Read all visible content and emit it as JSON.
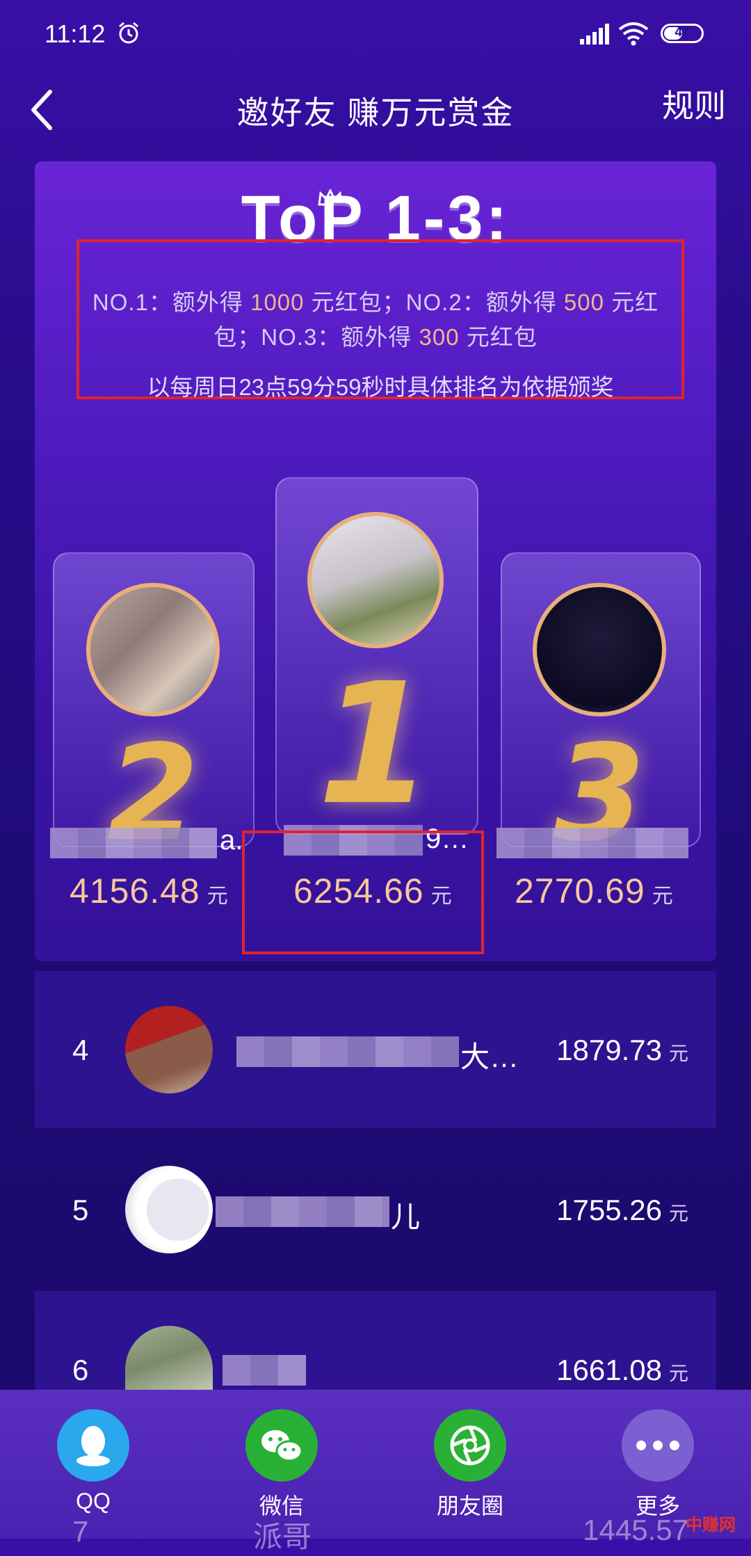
{
  "status_bar": {
    "time": "11:12",
    "battery": "47"
  },
  "header": {
    "title": "邀好友 赚万元赏金",
    "rules": "规则"
  },
  "top_section": {
    "title": "ToP 1-3:",
    "rule_line1": {
      "a": "NO.1：额外得 ",
      "n1": "1000",
      "b": " 元红包；NO.2：额外得 ",
      "n2": "500",
      "c": " 元红"
    },
    "rule_line2": {
      "a": "包；NO.3：额外得 ",
      "n3": "300",
      "b": " 元红包"
    },
    "note": "以每周日23点59分59秒时具体排名为依据颁奖"
  },
  "podium": [
    {
      "rank": "2",
      "name_suffix": "a.",
      "amount": "4156.48",
      "unit": "元"
    },
    {
      "rank": "1",
      "name_suffix": "9…",
      "amount": "6254.66",
      "unit": "元"
    },
    {
      "rank": "3",
      "name_suffix": "",
      "amount": "2770.69",
      "unit": "元"
    }
  ],
  "list": [
    {
      "rank": "4",
      "name_suffix": "大…",
      "amount": "1879.73",
      "unit": "元"
    },
    {
      "rank": "5",
      "name_suffix": "儿",
      "amount": "1755.26",
      "unit": "元"
    },
    {
      "rank": "6",
      "name_suffix": "",
      "amount": "1661.08",
      "unit": "元"
    },
    {
      "rank": "7",
      "name_suffix": "派哥",
      "amount": "1445.57",
      "unit": "元"
    }
  ],
  "share": [
    {
      "label": "QQ",
      "icon": "qq-icon",
      "color": "#2aa8ee"
    },
    {
      "label": "微信",
      "icon": "wechat-icon",
      "color": "#29b135"
    },
    {
      "label": "朋友圈",
      "icon": "moments-icon",
      "color": "#29b135"
    },
    {
      "label": "更多",
      "icon": "more-icon",
      "color": "#7c5fd0"
    }
  ],
  "watermark": "中赚网"
}
